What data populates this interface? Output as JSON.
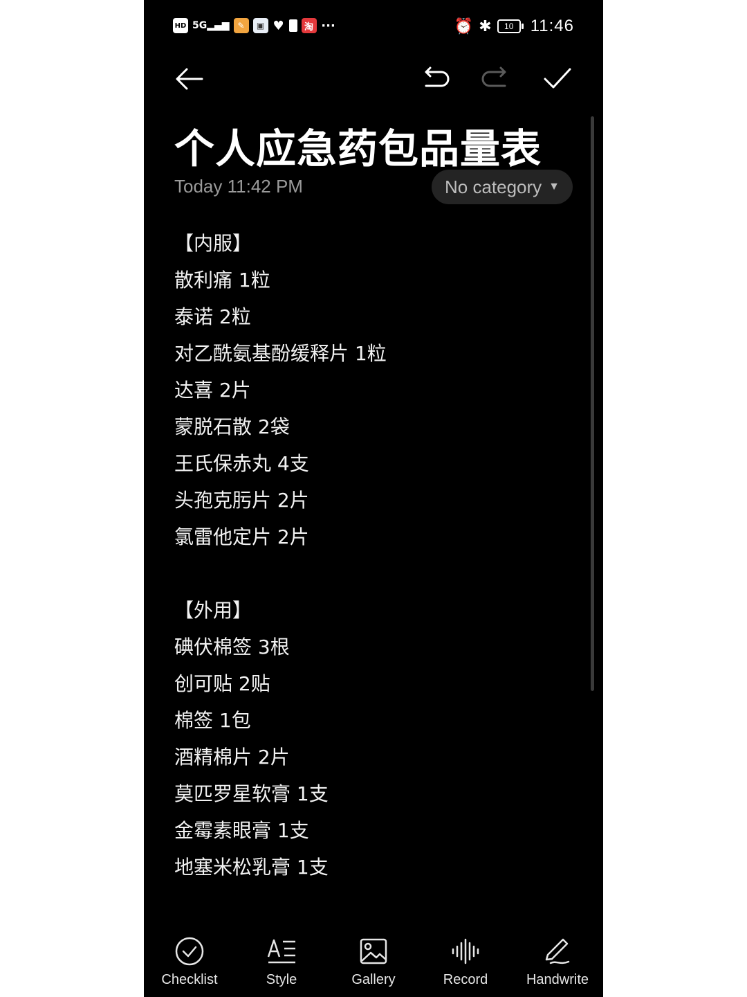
{
  "status_bar": {
    "hd": "HD",
    "network": "5G",
    "app_badge": "淘",
    "more": "···",
    "battery_level": "10",
    "time": "11:46"
  },
  "toolbar": {
    "back_icon": "arrow-left-icon",
    "undo_icon": "undo-icon",
    "redo_icon": "redo-icon",
    "done_icon": "checkmark-icon"
  },
  "note": {
    "title": "个人应急药包品量表",
    "date": "Today 11:42 PM",
    "category": "No category",
    "lines": [
      "【内服】",
      "散利痛 1粒",
      "泰诺 2粒",
      "对乙酰氨基酚缓释片 1粒",
      "达喜 2片",
      "蒙脱石散 2袋",
      "王氏保赤丸 4支",
      "头孢克肟片 2片",
      "氯雷他定片 2片",
      "【外用】",
      "碘伏棉签 3根",
      "创可贴 2贴",
      "棉签 1包",
      "酒精棉片 2片",
      "莫匹罗星软膏 1支",
      "金霉素眼膏 1支",
      "地塞米松乳膏 1支"
    ]
  },
  "bottom_bar": {
    "items": [
      {
        "label": "Checklist",
        "icon": "check-circle-icon"
      },
      {
        "label": "Style",
        "icon": "text-style-icon"
      },
      {
        "label": "Gallery",
        "icon": "image-icon"
      },
      {
        "label": "Record",
        "icon": "waveform-icon"
      },
      {
        "label": "Handwrite",
        "icon": "pen-icon"
      }
    ]
  },
  "colors": {
    "background": "#000000",
    "text": "#ffffff",
    "secondary_text": "#9a9a9a",
    "chip_background": "#242424"
  }
}
